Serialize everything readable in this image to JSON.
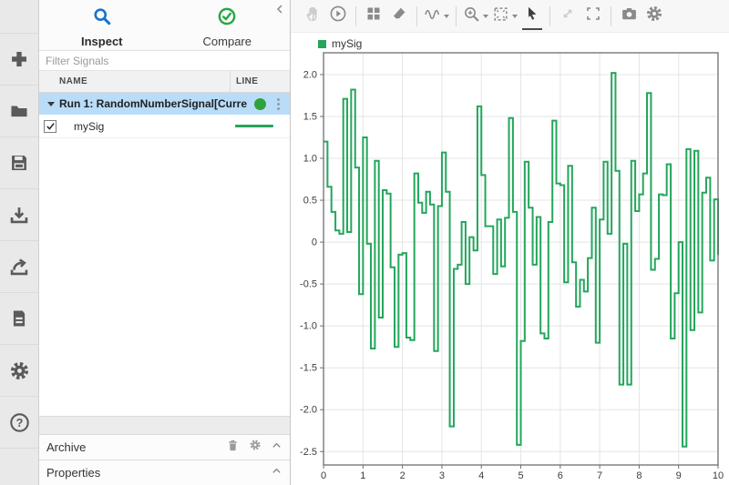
{
  "colors": {
    "signal_green": "#24a65c",
    "run_dot_green": "#2fa33b",
    "selection_blue": "#b9dcf8",
    "search_blue": "#1a73c8",
    "compare_green": "#28a745",
    "grid_gray": "#e4e4e4",
    "axis_gray": "#6e6e6e"
  },
  "left_toolbar": {
    "buttons": [
      {
        "icon": "add-icon"
      },
      {
        "icon": "open-folder-icon"
      },
      {
        "icon": "save-icon"
      },
      {
        "icon": "import-icon"
      },
      {
        "icon": "export-icon"
      },
      {
        "icon": "report-icon"
      },
      {
        "icon": "preferences-icon"
      },
      {
        "icon": "help-icon",
        "glyph": "?"
      }
    ]
  },
  "panel": {
    "tabs": [
      {
        "label": "Inspect",
        "icon": "search-icon",
        "active": true
      },
      {
        "label": "Compare",
        "icon": "compare-check-icon",
        "active": false
      }
    ],
    "filter_placeholder": "Filter Signals",
    "table": {
      "name_col": "NAME",
      "line_col": "LINE",
      "run_row": {
        "label": "Run 1: RandomNumberSignal[Curre",
        "selected": true
      },
      "signal_row": {
        "label": "mySig",
        "checked": true
      }
    },
    "archive_label": "Archive",
    "properties_label": "Properties"
  },
  "plot_toolbar": {
    "buttons": [
      {
        "icon": "pan-hand-icon",
        "disabled": true
      },
      {
        "icon": "replay-icon"
      },
      {
        "icon": "layout-grid-icon"
      },
      {
        "icon": "eraser-icon"
      },
      {
        "icon": "signal-wave-icon",
        "dropdown": true
      },
      {
        "icon": "zoom-in-icon",
        "dropdown": true
      },
      {
        "icon": "fit-to-view-icon",
        "dropdown": true
      },
      {
        "icon": "cursor-arrow-icon",
        "active": true
      },
      {
        "icon": "pan-zoom-icon",
        "disabled": true
      },
      {
        "icon": "fullscreen-icon"
      },
      {
        "icon": "snapshot-camera-icon"
      },
      {
        "icon": "plot-settings-icon"
      }
    ]
  },
  "chart_data": {
    "type": "line",
    "step": "post",
    "legend": [
      {
        "label": "mySig",
        "color": "#24a65c"
      }
    ],
    "grid": true,
    "xlim": [
      0,
      10
    ],
    "ylim_display": [
      -2.66,
      2.26
    ],
    "x_ticks": [
      0,
      1,
      2,
      3,
      4,
      5,
      6,
      7,
      8,
      9,
      10
    ],
    "y_tick_labels": [
      "2.0",
      "1.5",
      "1.0",
      "0.5",
      "0",
      "-0.5",
      "-1.0",
      "-1.5",
      "-2.0",
      "-2.5"
    ],
    "x_start": 0,
    "dt": 0.1,
    "values": [
      1.2,
      0.66,
      0.36,
      0.14,
      0.1,
      1.71,
      0.12,
      1.82,
      0.89,
      -0.62,
      1.25,
      -0.02,
      -1.27,
      0.97,
      -0.9,
      0.62,
      0.58,
      -0.3,
      -1.25,
      -0.15,
      -0.13,
      -1.14,
      -1.17,
      0.82,
      0.47,
      0.35,
      0.6,
      0.45,
      -1.3,
      0.43,
      1.07,
      0.6,
      -2.2,
      -0.32,
      -0.27,
      0.24,
      -0.5,
      0.06,
      -0.1,
      1.62,
      0.8,
      0.19,
      0.19,
      -0.38,
      0.27,
      -0.29,
      0.29,
      1.48,
      0.36,
      -2.42,
      -1.18,
      0.96,
      0.41,
      -0.27,
      0.3,
      -1.09,
      -1.15,
      0.24,
      1.45,
      0.7,
      0.68,
      -0.48,
      0.91,
      -0.24,
      -0.77,
      -0.45,
      -0.59,
      -0.19,
      0.41,
      -1.2,
      0.27,
      0.96,
      0.1,
      2.02,
      0.85,
      -1.7,
      -0.02,
      -1.7,
      0.97,
      0.37,
      0.57,
      0.82,
      1.78,
      -0.33,
      -0.2,
      0.57,
      0.56,
      0.93,
      -1.15,
      -0.61,
      0.0,
      -2.44,
      1.11,
      -1.05,
      1.09,
      -0.84,
      0.59,
      0.77,
      -0.22,
      0.51,
      -0.15
    ]
  }
}
